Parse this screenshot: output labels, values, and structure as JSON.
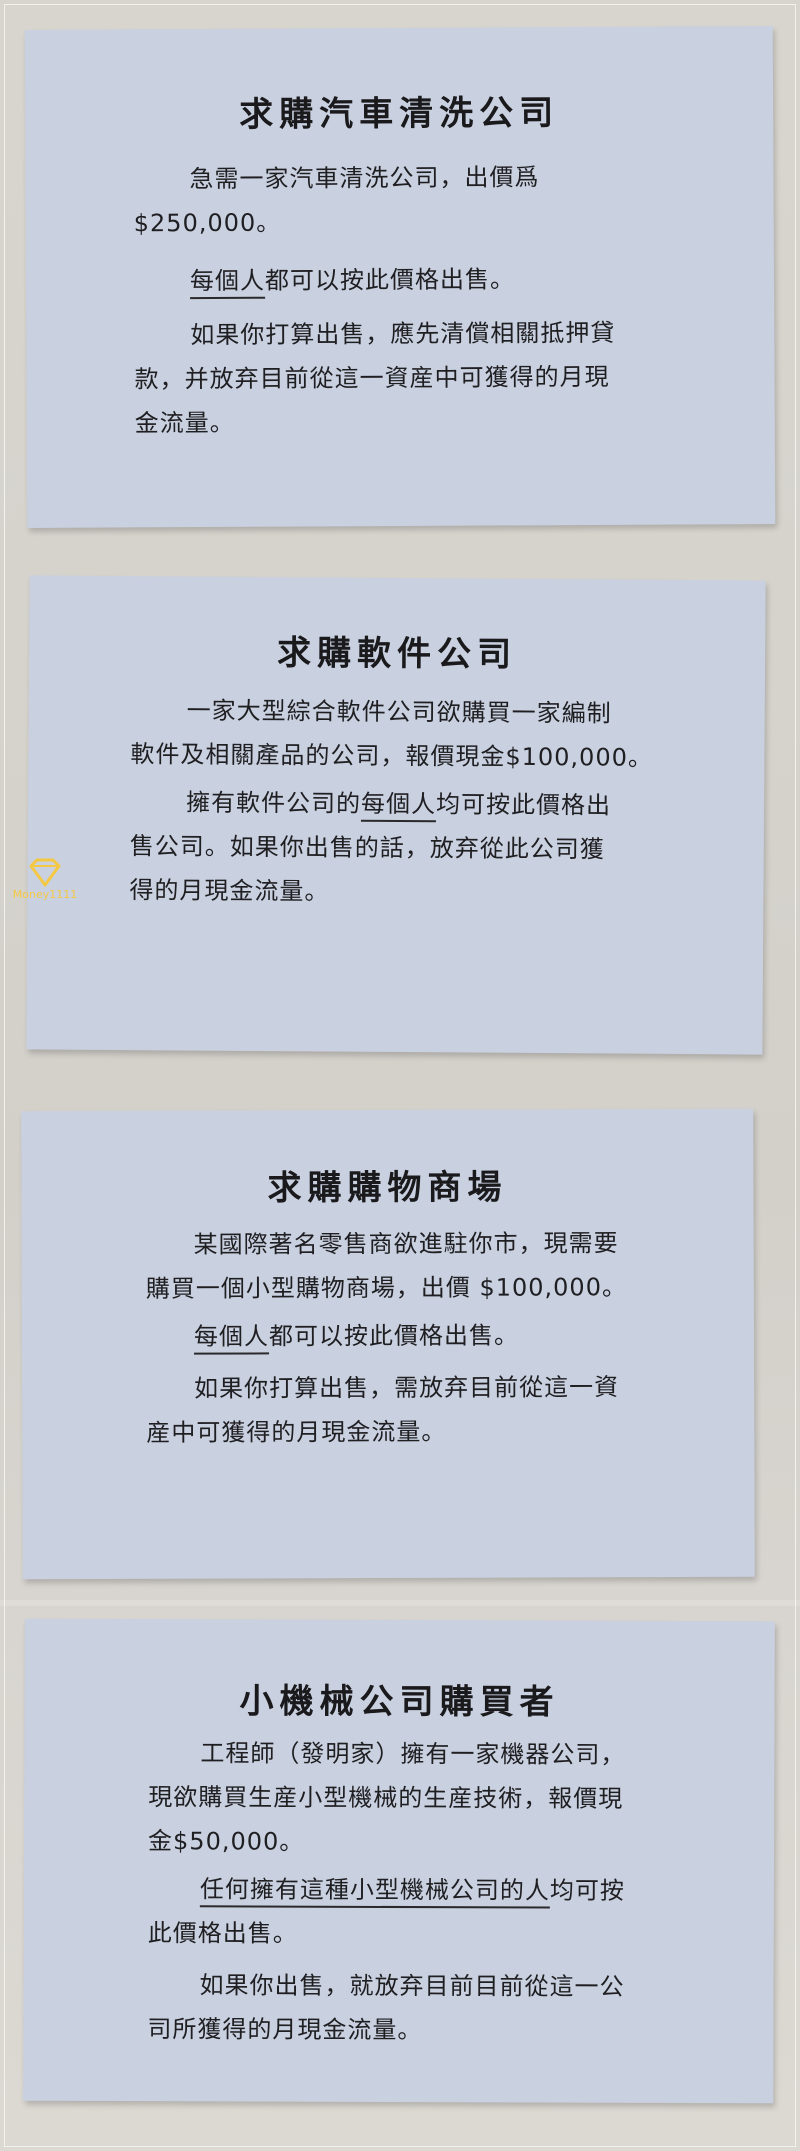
{
  "cards": [
    {
      "title": "求購汽車清洗公司",
      "p1_line1": "急需一家汽車清洗公司，出價爲",
      "p1_line2": "$250,000。",
      "p2_underline": "每個人",
      "p2_rest": "都可以按此價格出售。",
      "p3_line1": "如果你打算出售，應先清償相關抵押貸",
      "p3_line2": "款，并放弃目前從這一資産中可獲得的月現",
      "p3_line3": "金流量。"
    },
    {
      "title": "求購軟件公司",
      "p1_line1": "一家大型綜合軟件公司欲購買一家編制",
      "p1_line2": "軟件及相關產品的公司，報價現金$100,000。",
      "p2_pre": "擁有軟件公司的",
      "p2_underline": "每個人",
      "p2_rest": "均可按此價格出",
      "p2_line2": "售公司。如果你出售的話，放弃從此公司獲",
      "p2_line3": "得的月現金流量。"
    },
    {
      "title": "求購購物商場",
      "p1_line1": "某國際著名零售商欲進駐你市，現需要",
      "p1_line2": "購買一個小型購物商場，出價 $100,000。",
      "p2_underline": "每個人",
      "p2_rest": "都可以按此價格出售。",
      "p3_line1": "如果你打算出售，需放弃目前從這一資",
      "p3_line2": "産中可獲得的月現金流量。"
    },
    {
      "title": "小機械公司購買者",
      "p1_line1": "工程師（發明家）擁有一家機器公司，",
      "p1_line2": "現欲購買生産小型機械的生産技術，報價現",
      "p1_line3": "金$50,000。",
      "p2_underline": "任何擁有這種小型機械公司的人",
      "p2_rest": "均可按",
      "p2_line2": "此價格出售。",
      "p3_line1": "如果你出售，就放弃目前目前從這一公",
      "p3_line2": "司所獲得的月現金流量。"
    }
  ],
  "watermark": {
    "icon": "diamond-icon",
    "text": "Money1111",
    "color": "#f4c842"
  }
}
